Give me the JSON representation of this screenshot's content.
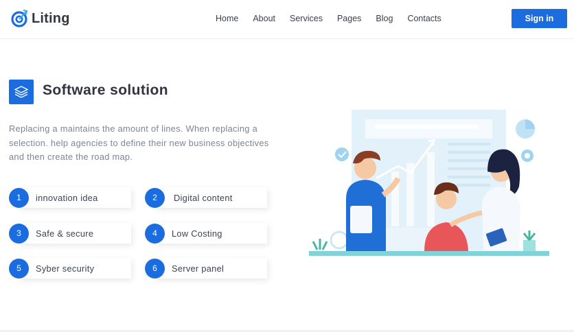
{
  "brand": {
    "name": "Liting",
    "logo_icon": "target-arrow-icon"
  },
  "nav": {
    "items": [
      "Home",
      "About",
      "Services",
      "Pages",
      "Blog",
      "Contacts"
    ]
  },
  "header": {
    "signin_label": "Sign in"
  },
  "section": {
    "icon": "layers-icon",
    "title": "Software solution",
    "description": "Replacing a maintains the amount of lines. When replacing a selection. help agencies to define their new business objectives and then create the road map."
  },
  "features": [
    {
      "num": "1",
      "label": "innovation idea"
    },
    {
      "num": "2",
      "label": "Digital content"
    },
    {
      "num": "3",
      "label": "Safe & secure"
    },
    {
      "num": "4",
      "label": "Low Costing"
    },
    {
      "num": "5",
      "label": "Syber security"
    },
    {
      "num": "6",
      "label": "Server panel"
    }
  ],
  "colors": {
    "accent": "#1a6cdf",
    "illustration_light": "#e3f1fa",
    "desk": "#7fd3d9"
  }
}
